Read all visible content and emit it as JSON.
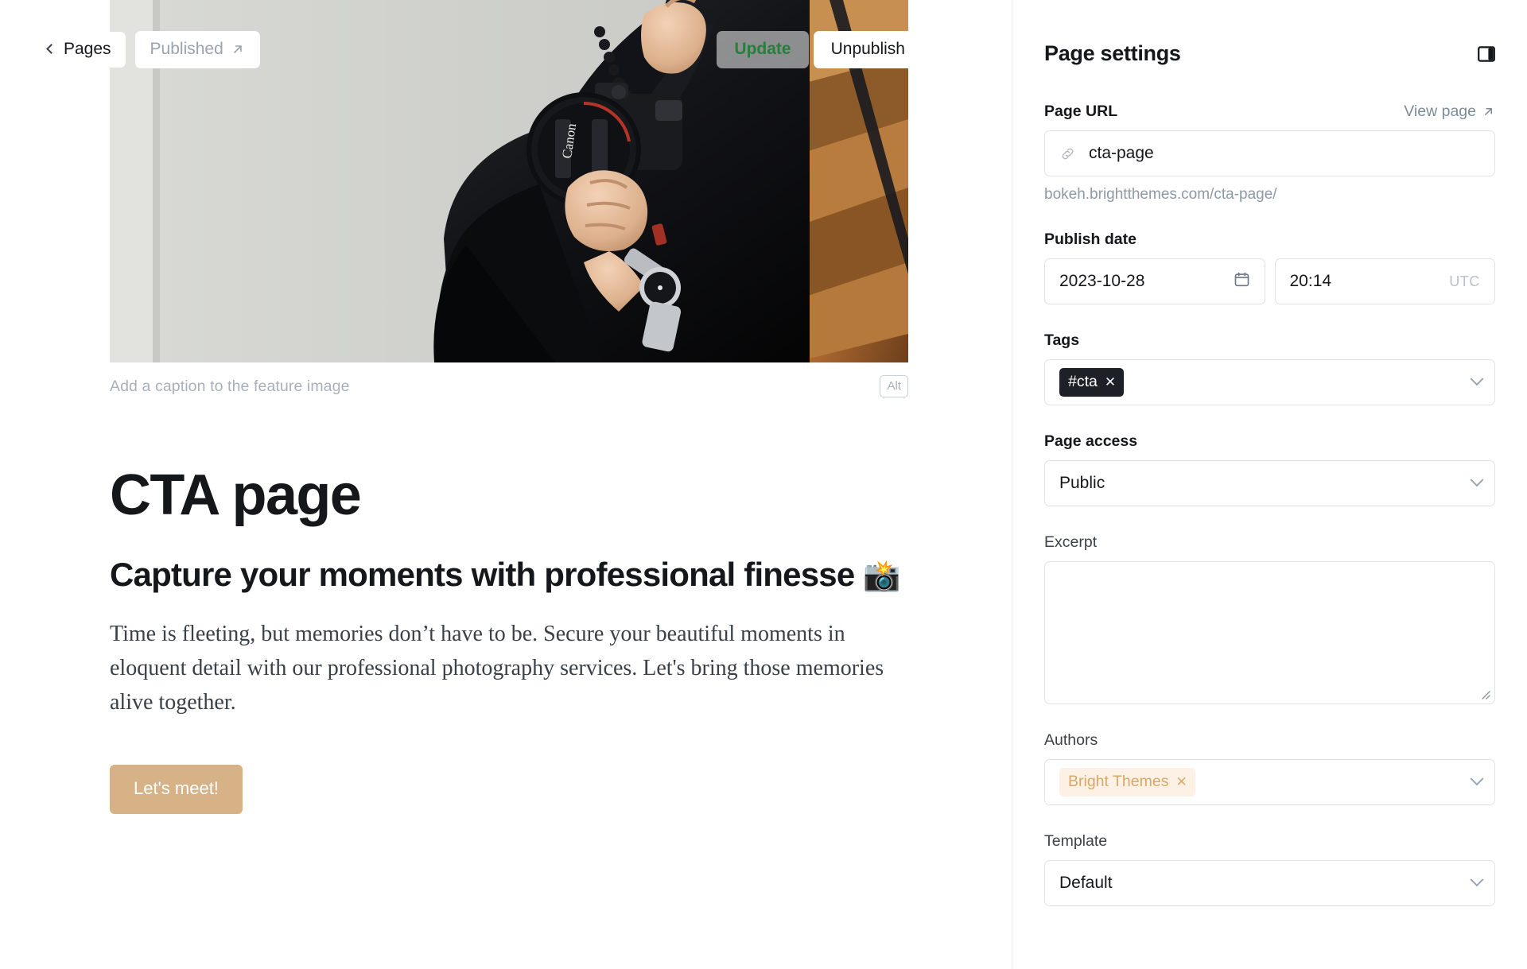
{
  "topbar": {
    "back_label": "Pages",
    "back_icon": "chevron-left-icon",
    "status_label": "Published",
    "status_icon": "arrow-up-right-icon",
    "update_label": "Update",
    "unpublish_label": "Unpublish",
    "update_color": "#267f3b"
  },
  "feature_image": {
    "alt_badge_label": "Alt",
    "caption_placeholder": "Add a caption to the feature image",
    "description": "Photographer crouching in black clothing holding a Canon DSLR camera beside a dark metal railing and wooden stairs"
  },
  "post": {
    "title": "CTA page",
    "heading": "Capture your moments with professional finesse",
    "heading_emoji": "📸",
    "paragraph": "Time is fleeting, but memories don’t have to be. Secure your beautiful moments in eloquent detail with our professional photography services. Let's bring those memories alive together.",
    "cta_label": "Let's meet!",
    "cta_color": "#d6b286"
  },
  "sidebar": {
    "title": "Page settings",
    "panel_toggle_icon": "sidebar-panel-icon",
    "page_url": {
      "label": "Page URL",
      "view_page_label": "View page",
      "view_page_icon": "arrow-up-right-icon",
      "url_icon": "link-icon",
      "value": "cta-page",
      "hint": "bokeh.brightthemes.com/cta-page/"
    },
    "publish_date": {
      "label": "Publish date",
      "date_value": "2023-10-28",
      "date_icon": "calendar-icon",
      "time_value": "20:14",
      "timezone": "UTC"
    },
    "tags": {
      "label": "Tags",
      "items": [
        {
          "label": "#cta",
          "remove_icon": "close-icon"
        }
      ],
      "chevron_icon": "chevron-down-icon"
    },
    "page_access": {
      "label": "Page access",
      "value": "Public",
      "chevron_icon": "chevron-down-icon"
    },
    "excerpt": {
      "label": "Excerpt",
      "value": "",
      "resize_icon": "resize-grip-icon"
    },
    "authors": {
      "label": "Authors",
      "items": [
        {
          "label": "Bright Themes",
          "remove_icon": "close-icon"
        }
      ],
      "chevron_icon": "chevron-down-icon"
    },
    "template": {
      "label": "Template",
      "value": "Default",
      "chevron_icon": "chevron-down-icon"
    }
  }
}
